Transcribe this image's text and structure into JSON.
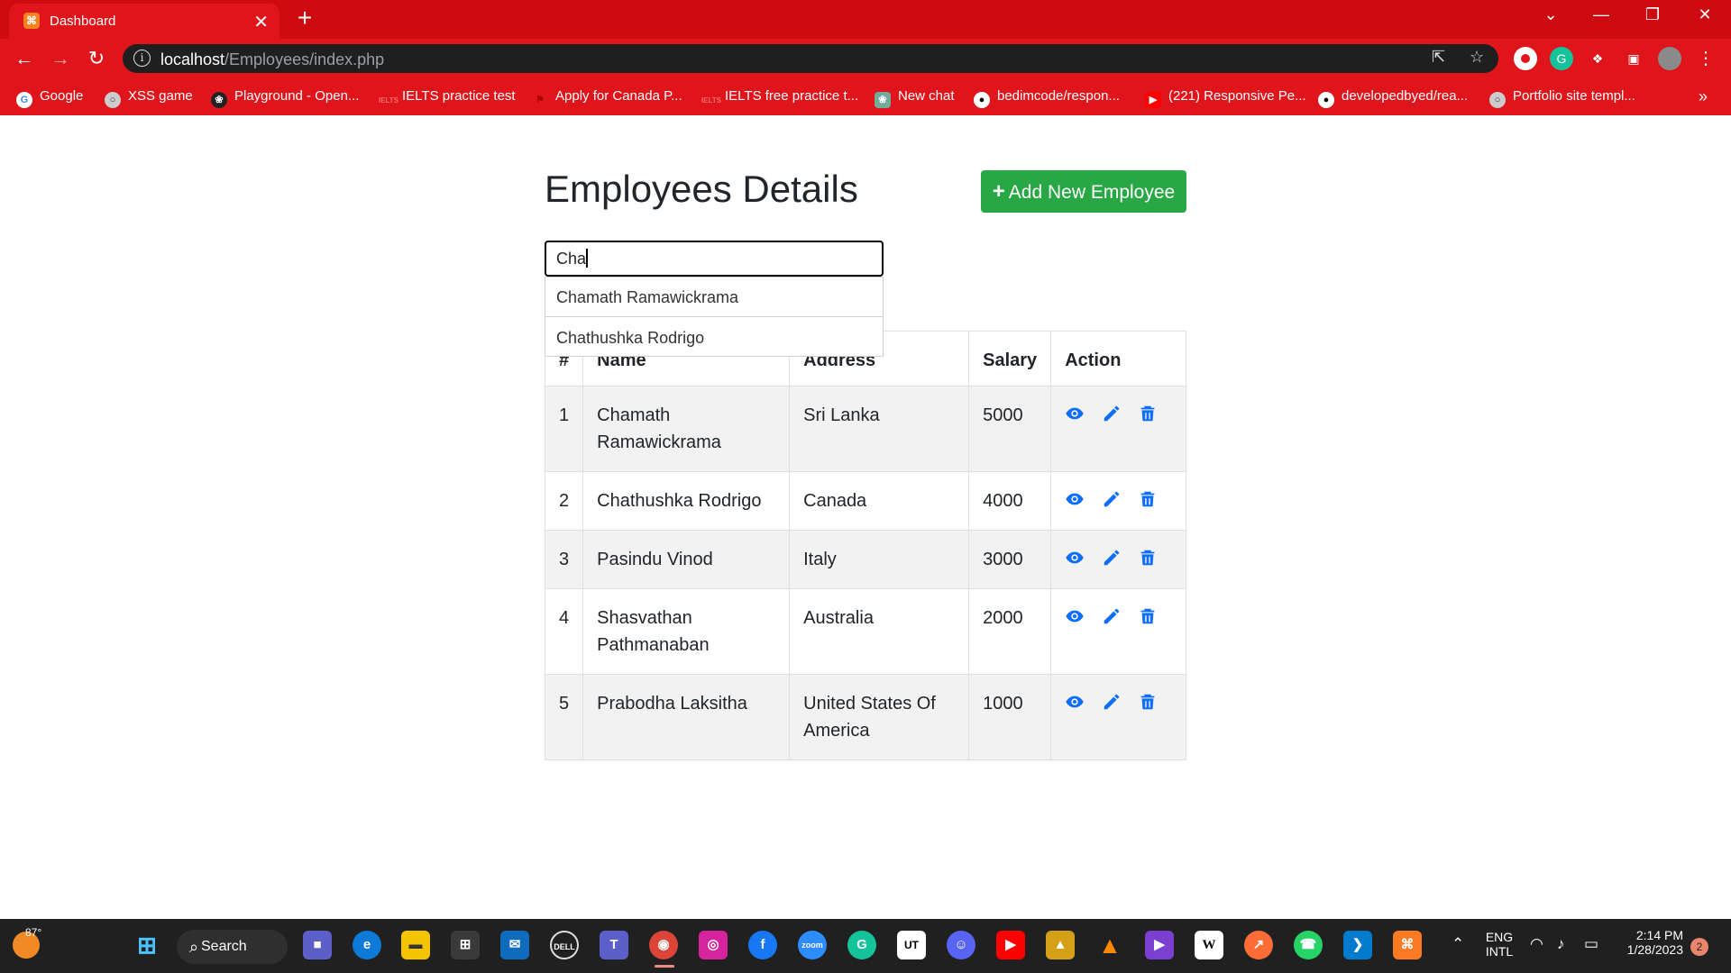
{
  "browser": {
    "tab_title": "Dashboard",
    "url_host": "localhost",
    "url_path": "/Employees/index.php",
    "accent_color": "#e0151b",
    "bookmarks": [
      {
        "label": "Google",
        "icon": "google-icon"
      },
      {
        "label": "XSS game",
        "icon": "globe-icon"
      },
      {
        "label": "Playground - Open...",
        "icon": "openai-icon"
      },
      {
        "label": "IELTS practice test",
        "icon": "ielts-icon"
      },
      {
        "label": "Apply for Canada P...",
        "icon": "canada-icon"
      },
      {
        "label": "IELTS free practice t...",
        "icon": "ielts-icon"
      },
      {
        "label": "New chat",
        "icon": "chatgpt-icon"
      },
      {
        "label": "bedimcode/respon...",
        "icon": "github-icon"
      },
      {
        "label": "(221) Responsive Pe...",
        "icon": "youtube-icon"
      },
      {
        "label": "developedbyed/rea...",
        "icon": "github-icon"
      },
      {
        "label": "Portfolio site templ...",
        "icon": "globe-icon"
      }
    ],
    "bookmarks_overflow": "»"
  },
  "page": {
    "title": "Employees Details",
    "add_button_label": "Add New Employee",
    "add_button_color": "#28a745",
    "search_value": "Cha",
    "suggestions": [
      "Chamath Ramawickrama",
      "Chathushka Rodrigo"
    ]
  },
  "table": {
    "headers": [
      "#",
      "Name",
      "Address",
      "Salary",
      "Action"
    ],
    "rows": [
      {
        "id": "1",
        "name": "Chamath Ramawickrama",
        "address": "Sri Lanka",
        "salary": "5000"
      },
      {
        "id": "2",
        "name": "Chathushka Rodrigo",
        "address": "Canada",
        "salary": "4000"
      },
      {
        "id": "3",
        "name": "Pasindu Vinod",
        "address": "Italy",
        "salary": "3000"
      },
      {
        "id": "4",
        "name": "Shasvathan Pathmanaban",
        "address": "Australia",
        "salary": "2000"
      },
      {
        "id": "5",
        "name": "Prabodha Laksitha",
        "address": "United States Of America",
        "salary": "1000"
      }
    ],
    "action_icons": [
      "eye-icon",
      "pencil-icon",
      "trash-icon"
    ],
    "action_color": "#0d6efd"
  },
  "taskbar": {
    "temperature": "87°",
    "search_label": "Search",
    "language_1": "ENG",
    "language_2": "INTL",
    "time": "2:14 PM",
    "date": "1/28/2023",
    "notification_count": "2"
  }
}
